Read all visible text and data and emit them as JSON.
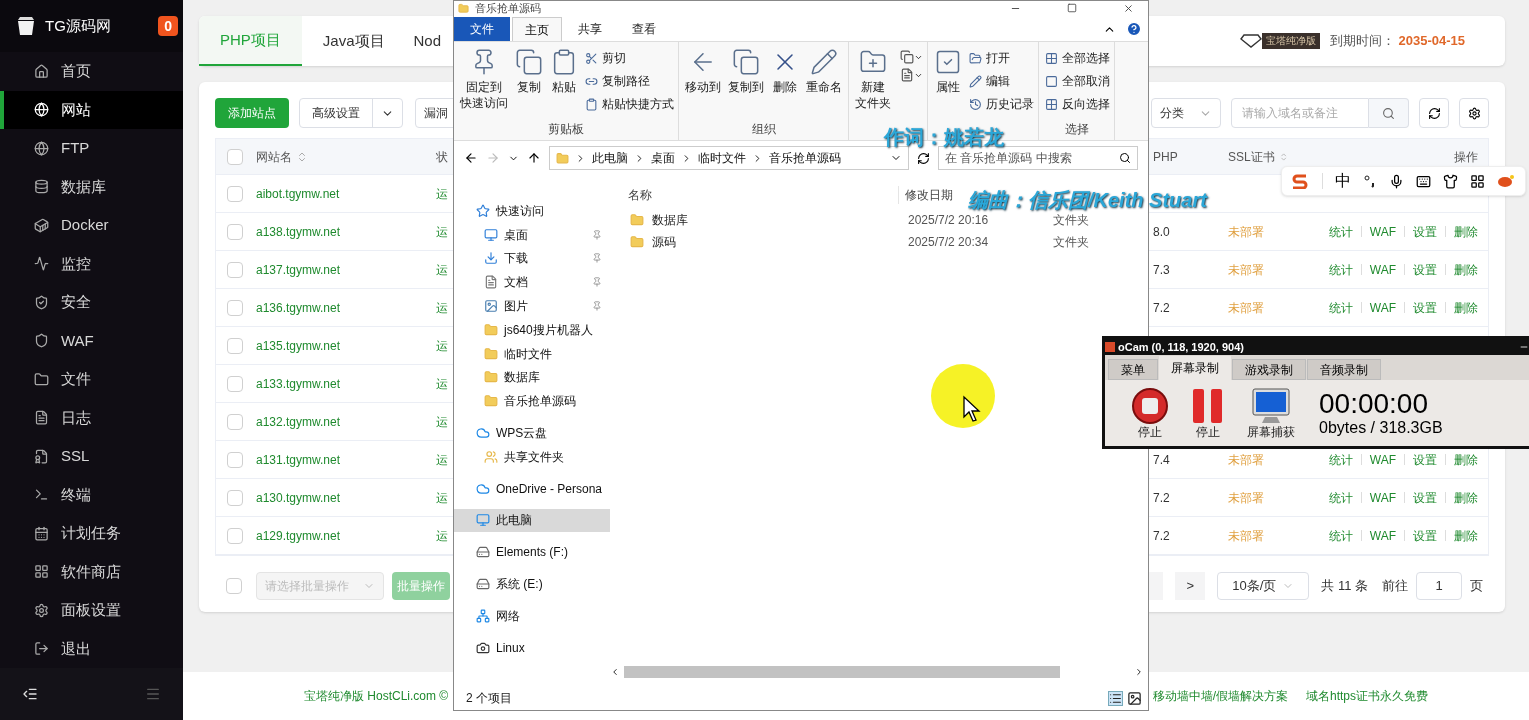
{
  "sidebar": {
    "brand": "TG源码网",
    "badge": "0",
    "items": [
      {
        "label": "首页",
        "selected": false
      },
      {
        "label": "网站",
        "selected": true
      },
      {
        "label": "FTP",
        "selected": false
      },
      {
        "label": "数据库",
        "selected": false
      },
      {
        "label": "Docker",
        "selected": false
      },
      {
        "label": "监控",
        "selected": false
      },
      {
        "label": "安全",
        "selected": false
      },
      {
        "label": "WAF",
        "selected": false
      },
      {
        "label": "文件",
        "selected": false
      },
      {
        "label": "日志",
        "selected": false
      },
      {
        "label": "SSL",
        "selected": false
      },
      {
        "label": "终端",
        "selected": false
      },
      {
        "label": "计划任务",
        "selected": false
      },
      {
        "label": "软件商店",
        "selected": false
      },
      {
        "label": "面板设置",
        "selected": false
      },
      {
        "label": "退出",
        "selected": false
      }
    ]
  },
  "header": {
    "tabs": [
      {
        "label": "PHP项目",
        "selected": true
      },
      {
        "label": "Java项目",
        "selected": false
      },
      {
        "label": "Nod",
        "selected": false
      }
    ],
    "edition_badge": "宝塔纯净版",
    "expiry_label": "到期时间：",
    "expiry_date": "2035-04-15"
  },
  "toolbar": {
    "add_button": "添加站点",
    "advanced_button": "高级设置",
    "scan_button": "漏洞",
    "category_select": "分类",
    "search": {
      "placeholder": "请输入域名或备注"
    }
  },
  "table": {
    "header_checked": false,
    "columns": [
      "网站名",
      "状",
      "PHP",
      "SSL证书",
      "操作"
    ],
    "rows": [
      {
        "checked": false,
        "name": "aibot.tgymw.net",
        "status": "运"
      },
      {
        "checked": false,
        "name": "a138.tgymw.net",
        "status": "运",
        "php": "8.0",
        "ssl": "未部署",
        "actions": [
          "统计",
          "WAF",
          "设置",
          "删除"
        ]
      },
      {
        "checked": false,
        "name": "a137.tgymw.net",
        "status": "运",
        "php": "7.3",
        "ssl": "未部署",
        "actions": [
          "统计",
          "WAF",
          "设置",
          "删除"
        ]
      },
      {
        "checked": false,
        "name": "a136.tgymw.net",
        "status": "运",
        "php": "7.2",
        "ssl": "未部署",
        "actions": [
          "统计",
          "WAF",
          "设置",
          "删除"
        ]
      },
      {
        "checked": false,
        "name": "a135.tgymw.net",
        "status": "运"
      },
      {
        "checked": false,
        "name": "a133.tgymw.net",
        "status": "运"
      },
      {
        "checked": false,
        "name": "a132.tgymw.net",
        "status": "运"
      },
      {
        "checked": false,
        "name": "a131.tgymw.net",
        "status": "运",
        "php": "7.4",
        "ssl": "未部署",
        "actions": [
          "统计",
          "WAF",
          "设置",
          "删除"
        ]
      },
      {
        "checked": false,
        "name": "a130.tgymw.net",
        "status": "运",
        "php": "7.2",
        "ssl": "未部署",
        "actions": [
          "统计",
          "WAF",
          "设置",
          "删除"
        ]
      },
      {
        "checked": false,
        "name": "a129.tgymw.net",
        "status": "运",
        "php": "7.2",
        "ssl": "未部署",
        "actions": [
          "统计",
          "WAF",
          "设置",
          "删除"
        ]
      }
    ]
  },
  "batch": {
    "checked": false,
    "select_placeholder": "请选择批量操作",
    "button": "批量操作",
    "disabled": true
  },
  "pagination": {
    "next": ">",
    "page_size": "10条/页",
    "total": "共 11 条",
    "goto_label": "前往",
    "page": "1",
    "page_suffix": "页"
  },
  "footer": {
    "copyright": "宝塔纯净版 HostCLi.com ©",
    "links": [
      "移动墙中墙/假墙解决方案",
      "域名https证书永久免费"
    ]
  },
  "explorer": {
    "title": "音乐抢单源码",
    "tabs": [
      {
        "label": "文件",
        "kind": "file",
        "selected": false
      },
      {
        "label": "主页",
        "kind": "tab",
        "selected": true
      },
      {
        "label": "共享",
        "kind": "tab",
        "selected": false
      },
      {
        "label": "查看",
        "kind": "tab",
        "selected": false
      }
    ],
    "groups": [
      {
        "label": "剪贴板",
        "kind": "standard",
        "big": [
          {
            "lines": [
              "固定到",
              "快速访问"
            ]
          },
          {
            "lines": [
              "复制"
            ]
          },
          {
            "lines": [
              "粘贴"
            ]
          }
        ],
        "small": [
          "剪切",
          "复制路径",
          "粘贴快捷方式"
        ]
      },
      {
        "label": "组织",
        "kind": "standard",
        "big": [
          {
            "lines": [
              "移动到"
            ]
          },
          {
            "lines": [
              "复制到"
            ]
          },
          {
            "lines": [
              "删除"
            ]
          },
          {
            "lines": [
              "重命名"
            ]
          }
        ]
      },
      {
        "kind": "new",
        "big": [
          {
            "lines": [
              "新建",
              "文件夹"
            ]
          }
        ]
      },
      {
        "kind": "standard",
        "big": [
          {
            "lines": [
              "属性"
            ]
          }
        ],
        "small": [
          "打开",
          "编辑",
          "历史记录"
        ]
      },
      {
        "label": "选择",
        "kind": "standard",
        "small": [
          "全部选择",
          "全部取消",
          "反向选择"
        ]
      }
    ],
    "path": [
      "此电脑",
      "桌面",
      "临时文件",
      "音乐抢单源码"
    ],
    "search": {
      "placeholder": "在 音乐抢单源码 中搜索"
    },
    "nav": [
      {
        "label": "快速访问",
        "kind": "star",
        "selected": false,
        "children": [
          {
            "label": "桌面",
            "kind": "desktop",
            "pinned": true,
            "selected": false
          },
          {
            "label": "下载",
            "kind": "download",
            "pinned": true,
            "selected": false
          },
          {
            "label": "文档",
            "kind": "document",
            "pinned": true,
            "selected": false
          },
          {
            "label": "图片",
            "kind": "image",
            "pinned": true,
            "selected": false
          },
          {
            "label": "js640搜片机器人",
            "kind": "folder",
            "pinned": false,
            "selected": false
          },
          {
            "label": "临时文件",
            "kind": "folder",
            "pinned": false,
            "selected": false
          },
          {
            "label": "数据库",
            "kind": "folder",
            "pinned": false,
            "selected": false
          },
          {
            "label": "音乐抢单源码",
            "kind": "folder",
            "pinned": false,
            "selected": false
          }
        ]
      },
      {
        "label": "WPS云盘",
        "kind": "cloud",
        "selected": false,
        "children": [
          {
            "label": "共享文件夹",
            "kind": "shared",
            "pinned": false,
            "selected": false
          }
        ]
      },
      {
        "label": "OneDrive - Persona",
        "kind": "cloud",
        "selected": false
      },
      {
        "label": "此电脑",
        "kind": "pc",
        "selected": true
      },
      {
        "label": "Elements (F:)",
        "kind": "drive",
        "selected": false
      },
      {
        "label": "系统 (E:)",
        "kind": "drive",
        "selected": false
      },
      {
        "label": "网络",
        "kind": "network",
        "selected": false
      },
      {
        "label": "Linux",
        "kind": "linux",
        "selected": false
      }
    ],
    "columns": [
      "名称",
      "修改日期"
    ],
    "files": [
      {
        "name": "数据库",
        "modified": "2025/7/2 20:16",
        "type": "文件夹"
      },
      {
        "name": "源码",
        "modified": "2025/7/2 20:34",
        "type": "文件夹"
      }
    ],
    "status": "2 个项目"
  },
  "ocam": {
    "title": "oCam (0, 118, 1920, 904)",
    "tabs": [
      {
        "label": "菜单",
        "selected": false
      },
      {
        "label": "屏幕录制",
        "selected": true
      },
      {
        "label": "游戏录制",
        "selected": false
      },
      {
        "label": "音频录制",
        "selected": false
      }
    ],
    "buttons": [
      {
        "kind": "stop",
        "label": "停止"
      },
      {
        "kind": "pause",
        "label": "停止"
      },
      {
        "kind": "capture",
        "label": "屏幕捕获"
      }
    ],
    "time": "00:00:00",
    "size": "0bytes / 318.3GB"
  },
  "ime_toolbar": {
    "mode": "中"
  },
  "subtitles": [
    "作词：姚若龙",
    "编曲：信乐团/Keith Stuart"
  ]
}
